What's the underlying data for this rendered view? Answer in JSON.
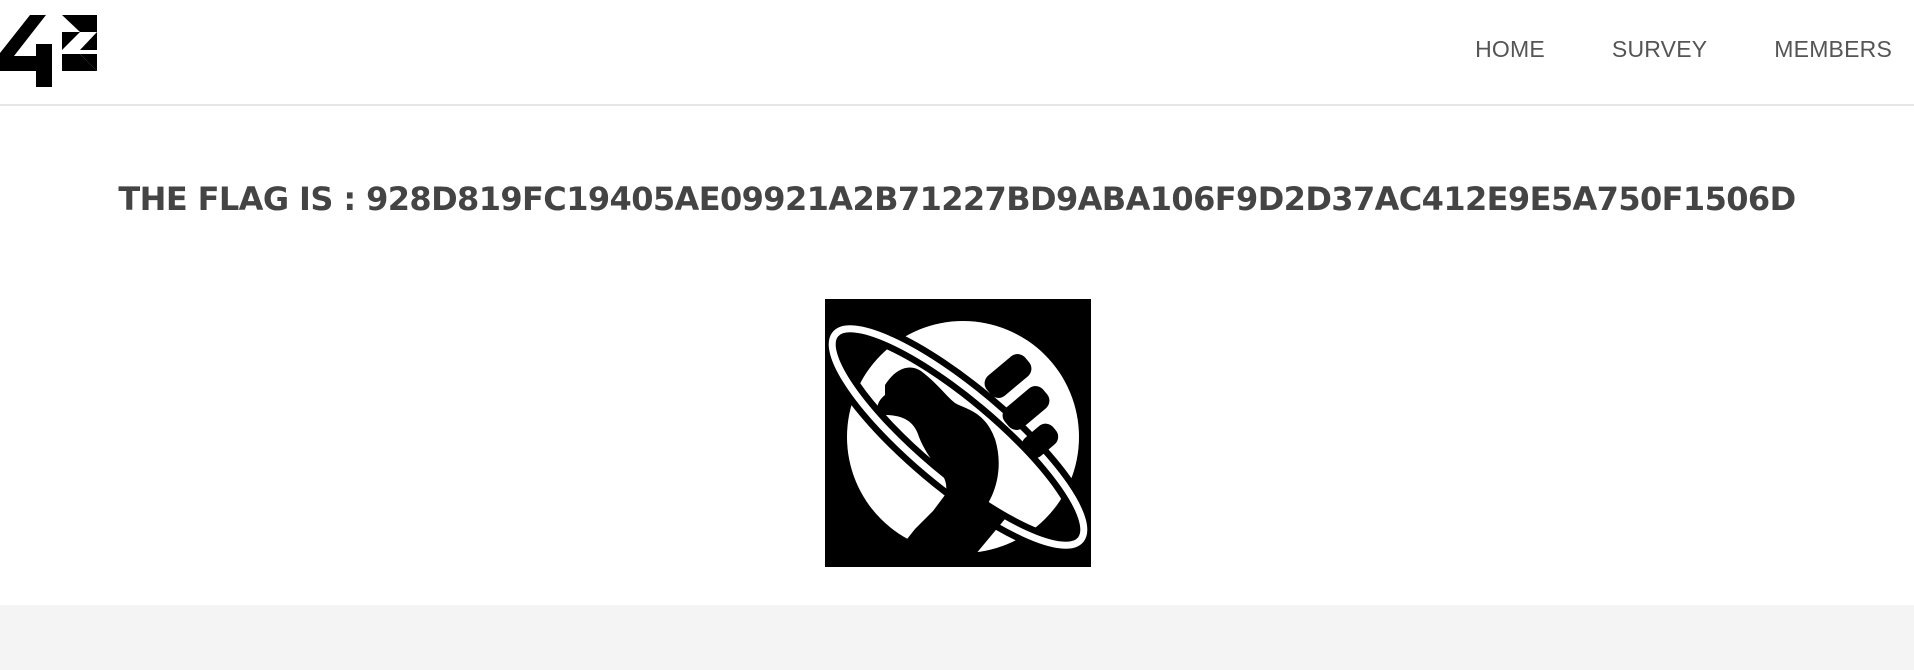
{
  "header": {
    "logo_name": "42-logo",
    "nav": [
      {
        "label": "HOME"
      },
      {
        "label": "SURVEY"
      },
      {
        "label": "MEMBERS"
      }
    ]
  },
  "main": {
    "flag_prefix": "THE FLAG IS :",
    "flag_value": "928D819FC19405AE09921A2B71227BD9ABA106F9D2D37AC412E9E5A750F1506D",
    "emblem_icon": "hitchhiker-thumb-planet-icon"
  },
  "colors": {
    "text": "#444444",
    "nav_text": "#555555",
    "header_border": "#e6e6e6",
    "footer_bg": "#f4f4f4",
    "emblem_bg": "#000000"
  }
}
